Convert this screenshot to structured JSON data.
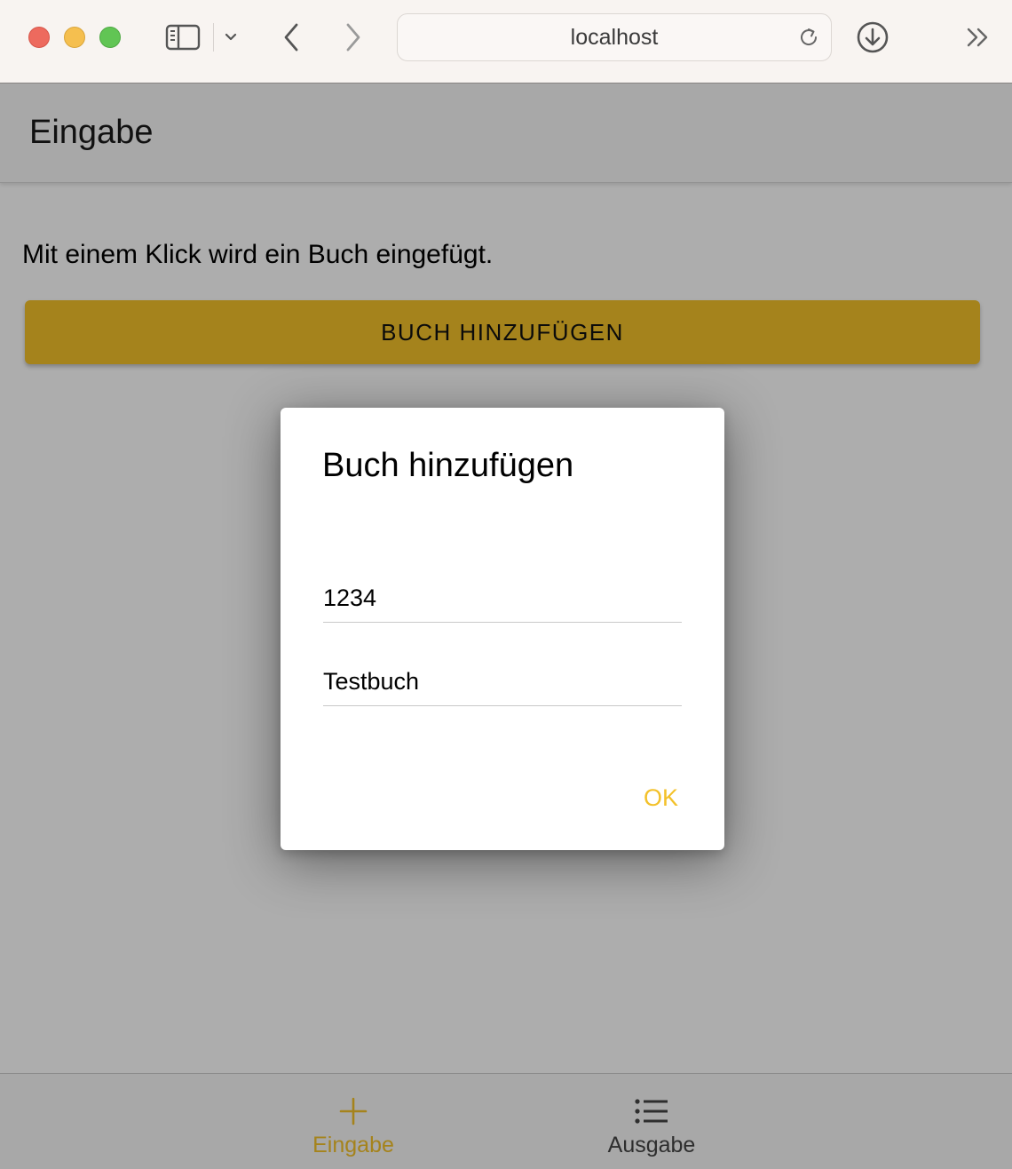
{
  "browser": {
    "address": "localhost"
  },
  "app": {
    "header_title": "Eingabe",
    "intro_text": "Mit einem Klick wird ein Buch eingefügt.",
    "add_button_label": "BUCH HINZUFÜGEN",
    "accent_color": "#f3c12a"
  },
  "dialog": {
    "title": "Buch hinzufügen",
    "isbn_value": "1234",
    "title_value": "Testbuch",
    "ok_label": "OK"
  },
  "tabbar": {
    "tabs": [
      {
        "label": "Eingabe",
        "icon": "plus-icon",
        "active": true
      },
      {
        "label": "Ausgabe",
        "icon": "list-icon",
        "active": false
      }
    ]
  }
}
